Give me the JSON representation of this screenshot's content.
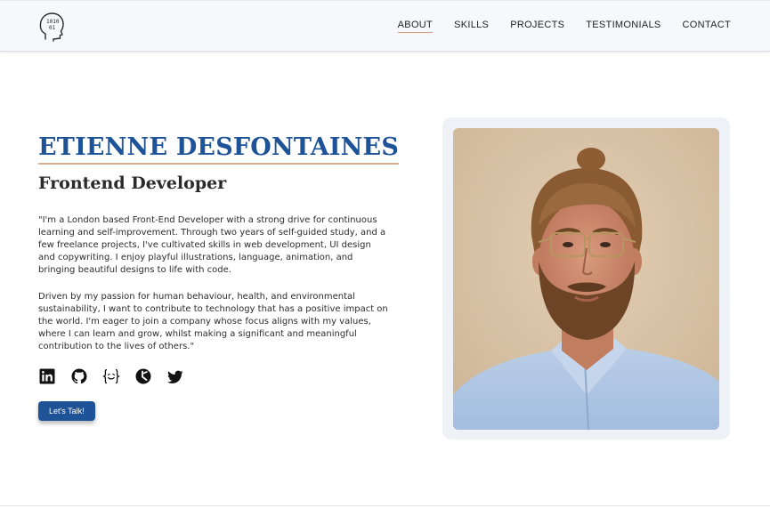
{
  "nav": {
    "items": [
      {
        "label": "ABOUT",
        "active": true
      },
      {
        "label": "SKILLS",
        "active": false
      },
      {
        "label": "PROJECTS",
        "active": false
      },
      {
        "label": "TESTIMONIALS",
        "active": false
      },
      {
        "label": "CONTACT",
        "active": false
      }
    ]
  },
  "logo": {
    "icon": "head-binary-icon",
    "lines": [
      "1010",
      "01"
    ]
  },
  "hero": {
    "name": "ETIENNE DESFONTAINES",
    "role": "Frontend Developer",
    "paragraph1": "\"I'm a London based Front-End Developer with a strong drive for continuous learning and self-improvement. Through two years of self-guided study, and a few freelance projects, I've cultivated skills in web development, UI design and copywriting. I enjoy playful illustrations, language, animation, and bringing beautiful designs to life with code.",
    "paragraph2": "Driven by my passion for human behaviour, health, and environmental sustainability, I want to contribute to technology that has a positive impact on the world. I'm eager to join a company whose focus aligns with my values, where I can learn and grow, whilst making a significant and meaningful contribution to the lives of others.\"",
    "cta_label": "Let's Talk!"
  },
  "socials": [
    {
      "icon": "linkedin-icon"
    },
    {
      "icon": "github-icon"
    },
    {
      "icon": "codewars-icon"
    },
    {
      "icon": "gitlab-clock-icon"
    },
    {
      "icon": "twitter-icon"
    }
  ],
  "colors": {
    "accent": "#1e5397",
    "underline": "#dcae92",
    "header_bg": "#f6f8fb",
    "photo_frame": "#eef1f6"
  },
  "photo": {
    "subject": "portrait-photo"
  }
}
